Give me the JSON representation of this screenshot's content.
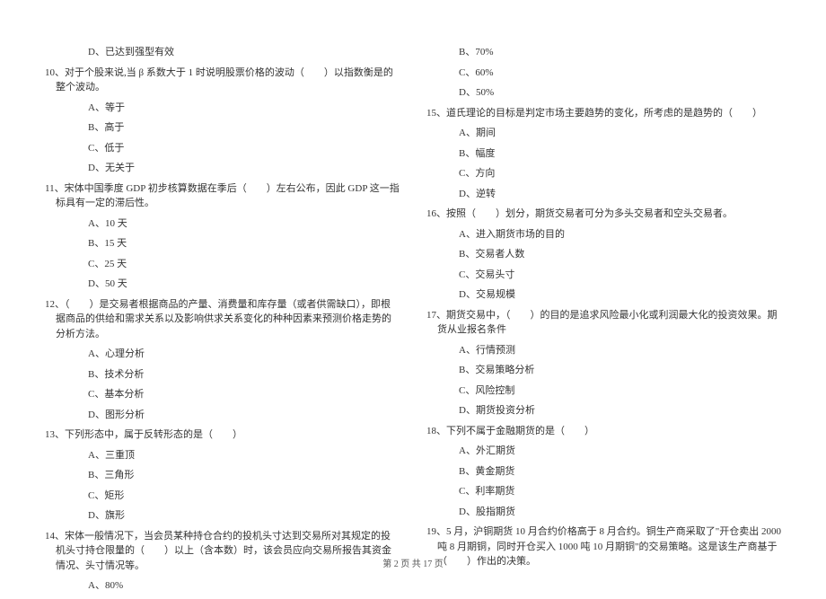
{
  "left": {
    "q9_d": "D、已达到强型有效",
    "q10": "10、对于个股来说,当 β 系数大于 1 时说明股票价格的波动（　　）以指数衡是的整个波动。",
    "q10_a": "A、等于",
    "q10_b": "B、高于",
    "q10_c": "C、低于",
    "q10_d": "D、无关于",
    "q11": "11、宋体中国季度 GDP 初步核算数据在季后（　　）左右公布，因此 GDP 这一指标具有一定的滞后性。",
    "q11_a": "A、10 天",
    "q11_b": "B、15 天",
    "q11_c": "C、25 天",
    "q11_d": "D、50 天",
    "q12": "12、（　　）是交易者根据商品的产量、消费量和库存量（或者供需缺口），即根据商品的供给和需求关系以及影响供求关系变化的种种因素来预测价格走势的分析方法。",
    "q12_a": "A、心理分析",
    "q12_b": "B、技术分析",
    "q12_c": "C、基本分析",
    "q12_d": "D、图形分析",
    "q13": "13、下列形态中，属于反转形态的是（　　）",
    "q13_a": "A、三重顶",
    "q13_b": "B、三角形",
    "q13_c": "C、矩形",
    "q13_d": "D、旗形",
    "q14": "14、宋体一般情况下，当会员某种持仓合约的投机头寸达到交易所对其规定的投机头寸持仓限量的（　　）以上（含本数）时，该会员应向交易所报告其资金情况、头寸情况等。",
    "q14_a": "A、80%"
  },
  "right": {
    "q14_b": "B、70%",
    "q14_c": "C、60%",
    "q14_d": "D、50%",
    "q15": "15、道氏理论的目标是判定市场主要趋势的变化，所考虑的是趋势的（　　）",
    "q15_a": "A、期间",
    "q15_b": "B、幅度",
    "q15_c": "C、方向",
    "q15_d": "D、逆转",
    "q16": "16、按照（　　）划分，期货交易者可分为多头交易者和空头交易者。",
    "q16_a": "A、进入期货市场的目的",
    "q16_b": "B、交易者人数",
    "q16_c": "C、交易头寸",
    "q16_d": "D、交易规模",
    "q17": "17、期货交易中，（　　）的目的是追求风险最小化或利润最大化的投资效果。期货从业报名条件",
    "q17_a": "A、行情预测",
    "q17_b": "B、交易策略分析",
    "q17_c": "C、风险控制",
    "q17_d": "D、期货投资分析",
    "q18": "18、下列不属于金融期货的是（　　）",
    "q18_a": "A、外汇期货",
    "q18_b": "B、黄金期货",
    "q18_c": "C、利率期货",
    "q18_d": "D、股指期货",
    "q19": "19、5 月，沪铜期货 10 月合约价格高于 8 月合约。铜生产商采取了\"开仓卖出 2000 吨 8 月期铜，同时开仓买入 1000 吨 10 月期铜\"的交易策略。这是该生产商基于（　　）作出的决策。"
  },
  "footer": "第 2 页 共 17 页"
}
